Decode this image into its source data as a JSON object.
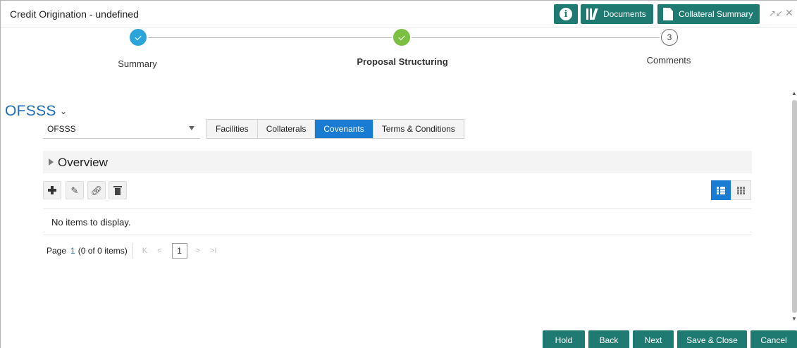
{
  "header": {
    "title": "Credit Origination - undefined",
    "info_icon": "info-icon",
    "documents_label": "Documents",
    "collateral_summary_label": "Collateral Summary",
    "expand_glyph": "↗↙",
    "close_glyph": "✕"
  },
  "stepper": {
    "steps": [
      {
        "label": "Summary",
        "state": "done"
      },
      {
        "label": "Proposal Structuring",
        "state": "current"
      },
      {
        "label": "Comments",
        "number": "3",
        "state": "pending"
      }
    ]
  },
  "entity": {
    "title": "OFSSS",
    "chevron": "⌄",
    "select_value": "OFSSS"
  },
  "tabs": [
    {
      "label": "Facilities",
      "active": false
    },
    {
      "label": "Collaterals",
      "active": false
    },
    {
      "label": "Covenants",
      "active": true
    },
    {
      "label": "Terms & Conditions",
      "active": false
    }
  ],
  "overview": {
    "label": "Overview",
    "toolbar": [
      "add-icon",
      "edit-icon",
      "link-icon",
      "delete-icon"
    ],
    "empty_message": "No items to display."
  },
  "pager": {
    "page_label": "Page",
    "page_number": "1",
    "items_text": "(0 of 0 items)",
    "first_glyph": "K",
    "prev_glyph": "<",
    "current_page": "1",
    "next_glyph": ">",
    "last_glyph": ">I"
  },
  "footer": {
    "hold_label": "Hold",
    "back_label": "Back",
    "next_label": "Next",
    "save_close_label": "Save & Close",
    "cancel_label": "Cancel"
  },
  "colors": {
    "teal_button": "#1f7a72",
    "active_blue": "#1a7bd2",
    "step_blue": "#2aa4d9",
    "step_green": "#7bc043",
    "title_blue": "#1a6dbf"
  }
}
